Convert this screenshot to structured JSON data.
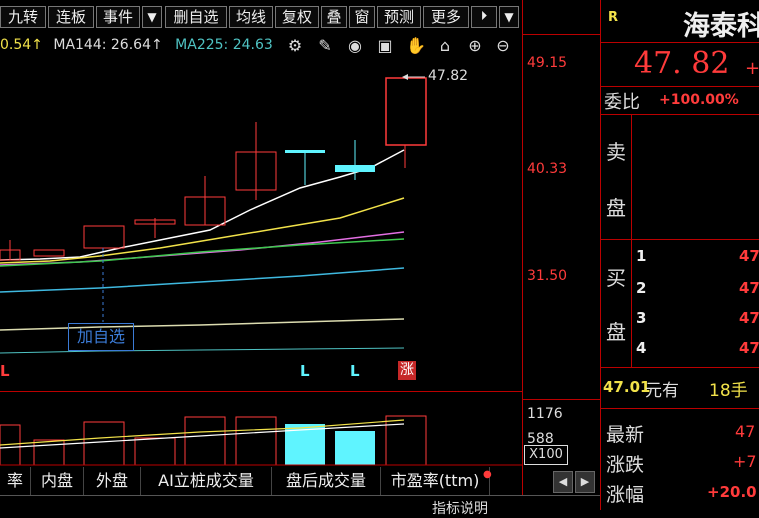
{
  "toolbar": {
    "items": [
      "九转",
      "连板",
      "事件",
      "▼",
      "删自选",
      "均线",
      "复权",
      "叠",
      "窗",
      "预测",
      "更多",
      "⏵",
      "▼"
    ]
  },
  "ma": {
    "ma_partial": "0.54↑",
    "ma144": "MA144: 26.64↑",
    "ma225": "MA225: 24.63"
  },
  "icons": [
    "gear-icon",
    "pen-icon",
    "eye-icon",
    "briefcase-icon",
    "hand-icon",
    "lock-icon",
    "zoom-in-icon",
    "zoom-out-icon"
  ],
  "price_axis": {
    "top": "49.15",
    "mid": "40.33",
    "low": "31.50",
    "last_price": "47.82"
  },
  "markers": {
    "add_watchlist": "加自选",
    "limit_up": "涨",
    "l_markers": [
      "L",
      "L"
    ],
    "left_l": "L"
  },
  "volume_axis": {
    "v1": "1176",
    "v2": "588",
    "unit": "X100"
  },
  "tabs": [
    "率",
    "内盘",
    "外盘",
    "AI立桩成交量",
    "盘后成交量",
    "市盈率(ttm)"
  ],
  "bottom_partial": "指标说明",
  "right_panel": {
    "badge": "R",
    "stock_name": "海泰科",
    "price": "47. 82",
    "price_sign": "+",
    "weibi_label": "委比",
    "weibi_value": "+100.00%",
    "sell_label_1": "卖",
    "sell_label_2": "盘",
    "buy_label_1": "买",
    "buy_label_2": "盘",
    "bid_levels": [
      "1",
      "2",
      "3",
      "4"
    ],
    "bid_prices": [
      "47",
      "47",
      "47",
      "47"
    ],
    "trade_line_value": "47.01",
    "trade_line_text": "元有",
    "trade_line_qty": "18手",
    "latest_label": "最新",
    "latest_value": "47",
    "change_label": "涨跌",
    "change_value": "+7",
    "pct_label": "涨幅",
    "pct_value": "+20.0"
  }
}
